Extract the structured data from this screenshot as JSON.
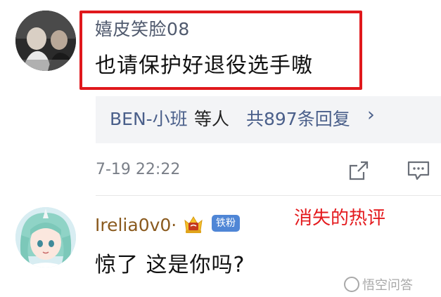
{
  "comment1": {
    "username": "嬉皮笑脸08",
    "text": "也请保护好退役选手嗷"
  },
  "replies": {
    "names": "BEN-小班",
    "mid": "等人",
    "count": "共897条回复",
    "chevron": "›"
  },
  "meta": {
    "timestamp": "7-19 22:22",
    "share_icon": "share-icon",
    "comment_icon": "comment-icon"
  },
  "comment2": {
    "username": "Irelia0v0·",
    "fan_badge": "铁粉",
    "annotation": "消失的热评",
    "text": "惊了 这是你吗?"
  },
  "watermark": {
    "text": "悟空问答"
  },
  "colors": {
    "highlight": "#e0181c",
    "link_blue": "#4a5f8a",
    "username_gold": "#8a5a1e",
    "badge_blue": "#4f86d6",
    "annotation_red": "#e4191d"
  }
}
